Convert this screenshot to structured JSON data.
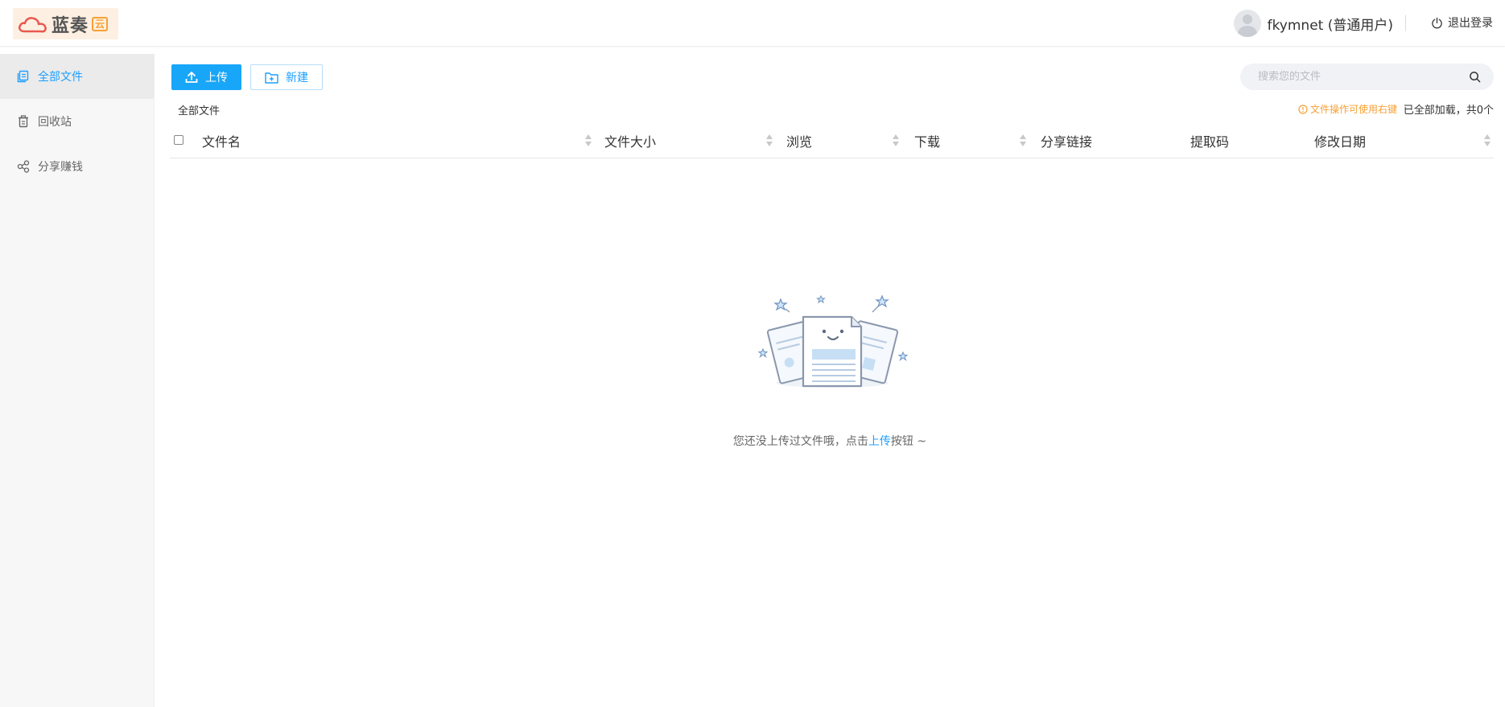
{
  "header": {
    "logo_text": "蓝奏",
    "logo_badge": "云",
    "username": "fkymnet (普通用户)",
    "logout_label": "退出登录"
  },
  "sidebar": {
    "items": [
      {
        "label": "全部文件",
        "icon": "files-icon",
        "active": true
      },
      {
        "label": "回收站",
        "icon": "trash-icon",
        "active": false
      },
      {
        "label": "分享赚钱",
        "icon": "share-icon",
        "active": false
      }
    ]
  },
  "toolbar": {
    "upload_label": "上传",
    "new_label": "新建"
  },
  "search": {
    "placeholder": "搜索您的文件"
  },
  "breadcrumb": "全部文件",
  "tip": "文件操作可使用右键",
  "status": "已全部加载，共0个",
  "table": {
    "columns": [
      "文件名",
      "文件大小",
      "浏览",
      "下载",
      "分享链接",
      "提取码",
      "修改日期"
    ]
  },
  "empty": {
    "text_before": "您还没上传过文件哦，点击",
    "link": "上传",
    "text_after": "按钮 ~"
  },
  "colors": {
    "accent": "#1e9fff",
    "upload_button": "#18a6f8",
    "tip": "#f7a035"
  }
}
